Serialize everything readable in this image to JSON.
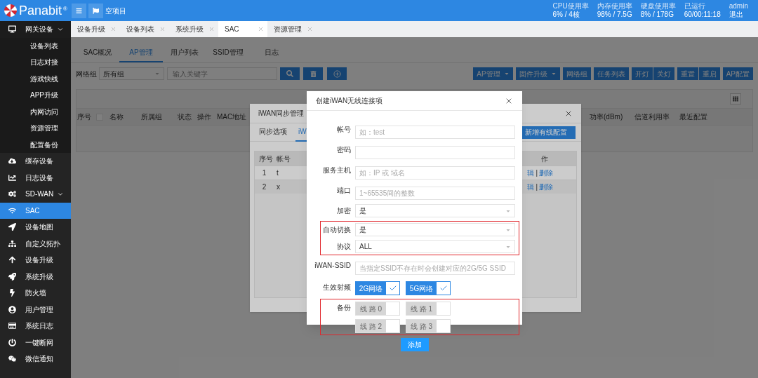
{
  "header": {
    "logo_text": "Panabit",
    "logo_mark": "®",
    "project": "空项目",
    "stats": [
      {
        "label": "CPU使用率",
        "value": "6% / 4核"
      },
      {
        "label": "内存使用率",
        "value": "98% / 7.5G"
      },
      {
        "label": "硬盘使用率",
        "value": "8% / 178G"
      },
      {
        "label": "已运行",
        "value": "60/00:11:18"
      },
      {
        "label": "admin",
        "value": "退出"
      }
    ]
  },
  "sidebar": {
    "items": [
      {
        "label": "网关设备",
        "kind": "group",
        "selected": false,
        "children": [
          {
            "label": "设备列表",
            "selected": false
          },
          {
            "label": "日志对接",
            "selected": false
          },
          {
            "label": "游戏快线",
            "selected": false
          },
          {
            "label": "APP升级",
            "selected": false
          },
          {
            "label": "内网访问",
            "selected": false
          },
          {
            "label": "资源管理",
            "selected": false
          },
          {
            "label": "配置备份",
            "selected": false
          }
        ]
      },
      {
        "label": "缓存设备",
        "kind": "link",
        "selected": false
      },
      {
        "label": "日志设备",
        "kind": "link",
        "selected": false
      },
      {
        "label": "SD-WAN",
        "kind": "group",
        "selected": false
      },
      {
        "label": "SAC",
        "kind": "link",
        "selected": true
      },
      {
        "label": "设备地图",
        "kind": "link",
        "selected": false
      },
      {
        "label": "自定义拓扑",
        "kind": "link",
        "selected": false
      },
      {
        "label": "设备升级",
        "kind": "link",
        "selected": false
      },
      {
        "label": "系统升级",
        "kind": "link",
        "selected": false
      },
      {
        "label": "防火墙",
        "kind": "link",
        "selected": false
      },
      {
        "label": "用户管理",
        "kind": "link",
        "selected": false
      },
      {
        "label": "系统日志",
        "kind": "link",
        "selected": false
      },
      {
        "label": "一键断网",
        "kind": "link",
        "selected": false
      },
      {
        "label": "微信通知",
        "kind": "link",
        "selected": false
      }
    ]
  },
  "tabs": [
    {
      "label": "设备升级",
      "selected": false
    },
    {
      "label": "设备列表",
      "selected": false
    },
    {
      "label": "系统升级",
      "selected": false
    },
    {
      "label": "SAC",
      "selected": true
    },
    {
      "label": "资源管理",
      "selected": false
    }
  ],
  "sub_tabs": [
    {
      "label": "SAC概况",
      "selected": false
    },
    {
      "label": "AP管理",
      "selected": true
    },
    {
      "label": "用户列表",
      "selected": false
    },
    {
      "label": "SSID管理",
      "selected": false
    },
    {
      "label": "日志",
      "selected": false
    }
  ],
  "toolbar": {
    "group_label": "网络组",
    "group_value": "所有组",
    "search": {
      "placeholder": "输入关键字"
    },
    "actions": [
      {
        "kind": "dropdown",
        "labels": [
          "AP管理"
        ]
      },
      {
        "kind": "dropdown",
        "labels": [
          "固件升级"
        ]
      },
      {
        "kind": "button",
        "labels": [
          "网络组"
        ]
      },
      {
        "kind": "button",
        "labels": [
          "任务列表"
        ]
      },
      {
        "kind": "button",
        "labels": [
          "开灯",
          "关灯"
        ]
      },
      {
        "kind": "button",
        "labels": [
          "重置",
          "重启"
        ]
      },
      {
        "kind": "button",
        "labels": [
          "AP配置"
        ]
      }
    ]
  },
  "ap_table": {
    "columns": [
      {
        "kind": "text",
        "label": "序号"
      },
      {
        "kind": "checkbox",
        "checked": false
      },
      {
        "kind": "text",
        "label": "名称"
      },
      {
        "kind": "text",
        "label": "所属组"
      },
      {
        "kind": "text",
        "label": "状态"
      },
      {
        "kind": "text",
        "label": "操作"
      },
      {
        "kind": "text",
        "label": "MAC地址"
      },
      {
        "kind": "text",
        "label": "功率(dBm)"
      },
      {
        "kind": "text",
        "label": "信道利用率"
      },
      {
        "kind": "text",
        "label": "最近配置"
      }
    ]
  },
  "iwan_dialog": {
    "title": "iWAN同步管理",
    "tabs": [
      {
        "label": "同步选项",
        "selected": false
      },
      {
        "label": "iW",
        "selected": true
      }
    ],
    "add_button": "新增有线配置",
    "columns": [
      "序号",
      "帐号"
    ],
    "action_column": "作",
    "rows": [
      {
        "index": "1",
        "account": "t",
        "links": [
          "辑",
          "删除"
        ],
        "separator": "|"
      },
      {
        "index": "2",
        "account": "x",
        "links": [
          "辑",
          "删除"
        ],
        "separator": "|"
      }
    ]
  },
  "create_dialog": {
    "title": "创建iWAN无线连接项",
    "fields": [
      {
        "label": "帐号",
        "kind": "input",
        "placeholder": "如：test",
        "highlighted": false
      },
      {
        "label": "密码",
        "kind": "input",
        "highlighted": false
      },
      {
        "label": "服务主机",
        "kind": "input",
        "placeholder": "如：IP 或 域名",
        "highlighted": false
      },
      {
        "label": "端口",
        "kind": "input",
        "placeholder": "1~65535间的整数",
        "highlighted": false
      },
      {
        "label": "加密",
        "kind": "select",
        "value": "是",
        "highlighted": false
      },
      {
        "label": "自动切换",
        "kind": "select",
        "value": "是",
        "highlighted": true
      },
      {
        "label": "协议",
        "kind": "select",
        "value": "ALL",
        "highlighted": true
      },
      {
        "label": "iWAN-SSID",
        "kind": "input",
        "placeholder": "当指定SSID不存在时会创建对应的2G/5G SSID",
        "highlighted": false
      },
      {
        "label": "生效射频",
        "kind": "checks",
        "highlighted": false,
        "options": [
          {
            "label": "2G网络",
            "checked": true
          },
          {
            "label": "5G网络",
            "checked": true
          }
        ]
      },
      {
        "label": "备份",
        "kind": "checks",
        "highlighted": true,
        "options": [
          {
            "label": "线 路 0",
            "checked": false
          },
          {
            "label": "线 路 1",
            "checked": false
          },
          {
            "label": "线 路 2",
            "checked": false
          },
          {
            "label": "线 路 3",
            "checked": false
          }
        ]
      }
    ],
    "submit": "添加"
  }
}
